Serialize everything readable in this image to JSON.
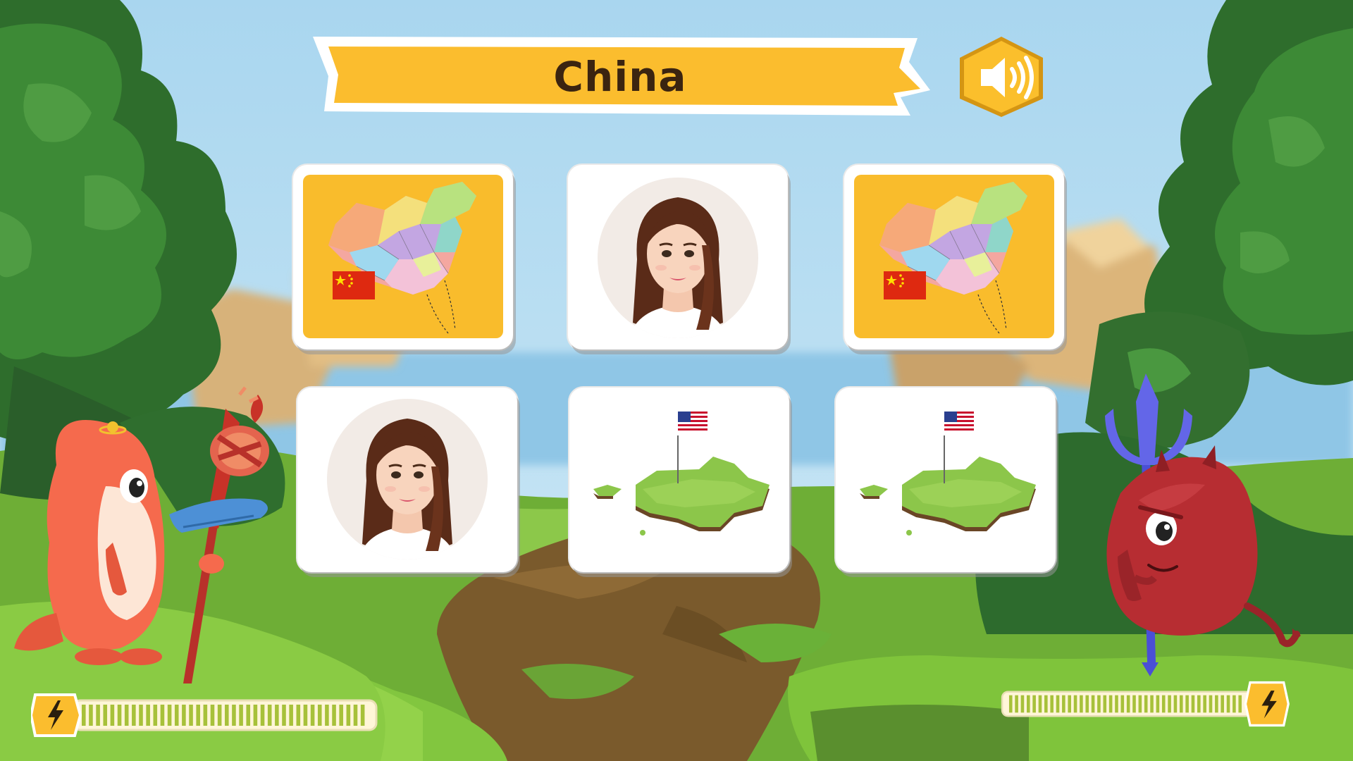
{
  "title": {
    "text": "China"
  },
  "speaker": {
    "icon": "speaker-icon"
  },
  "cards": [
    {
      "content": "china-map",
      "bg": "yellow"
    },
    {
      "content": "woman-portrait",
      "bg": "white"
    },
    {
      "content": "china-map",
      "bg": "yellow"
    },
    {
      "content": "woman-portrait",
      "bg": "white"
    },
    {
      "content": "usa-map",
      "bg": "white"
    },
    {
      "content": "usa-map",
      "bg": "white"
    }
  ],
  "player": {
    "character": "orange-platypus-wizard",
    "energy": 1.0
  },
  "enemy": {
    "character": "red-devil-blob",
    "energy": 1.0
  },
  "colors": {
    "sky": "#a9d6ef",
    "banner": "#fbbd2e",
    "card_yellow": "#f9bc2c",
    "grass": "#7fc43b",
    "energy": "#a7c13a",
    "title_text": "#3b2410"
  }
}
